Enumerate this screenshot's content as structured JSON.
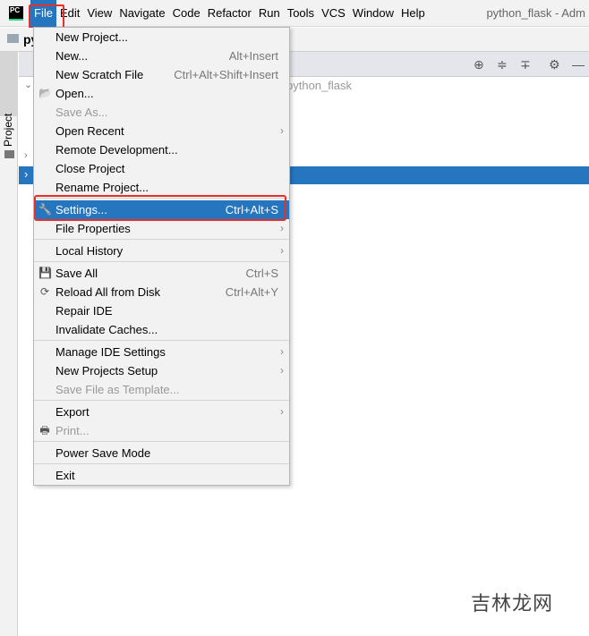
{
  "menubar": {
    "items": [
      "File",
      "Edit",
      "View",
      "Navigate",
      "Code",
      "Refactor",
      "Run",
      "Tools",
      "VCS",
      "Window",
      "Help"
    ],
    "title": "python_flask - Adm",
    "logo": "PC"
  },
  "navbar": {
    "project": "py"
  },
  "sidebar": {
    "label": "Project"
  },
  "tree": {
    "root_path": "python_flask"
  },
  "file_menu": [
    {
      "label": "New Project...",
      "shortcut": ""
    },
    {
      "label": "New...",
      "shortcut": "Alt+Insert"
    },
    {
      "label": "New Scratch File",
      "shortcut": "Ctrl+Alt+Shift+Insert"
    },
    {
      "label": "Open...",
      "shortcut": "",
      "icon": "folder-open-icon"
    },
    {
      "label": "Save As...",
      "shortcut": "",
      "disabled": true
    },
    {
      "label": "Open Recent",
      "shortcut": "",
      "submenu": true
    },
    {
      "label": "Remote Development...",
      "shortcut": ""
    },
    {
      "label": "Close Project",
      "shortcut": ""
    },
    {
      "label": "Rename Project...",
      "shortcut": ""
    },
    {
      "separator": true
    },
    {
      "label": "Settings...",
      "shortcut": "Ctrl+Alt+S",
      "icon": "wrench-icon",
      "highlighted": true
    },
    {
      "label": "File Properties",
      "shortcut": "",
      "submenu": true
    },
    {
      "separator": true
    },
    {
      "label": "Local History",
      "shortcut": "",
      "submenu": true
    },
    {
      "separator": true
    },
    {
      "label": "Save All",
      "shortcut": "Ctrl+S",
      "icon": "save-icon"
    },
    {
      "label": "Reload All from Disk",
      "shortcut": "Ctrl+Alt+Y",
      "icon": "reload-icon"
    },
    {
      "label": "Repair IDE",
      "shortcut": ""
    },
    {
      "label": "Invalidate Caches...",
      "shortcut": ""
    },
    {
      "separator": true
    },
    {
      "label": "Manage IDE Settings",
      "shortcut": "",
      "submenu": true
    },
    {
      "label": "New Projects Setup",
      "shortcut": "",
      "submenu": true
    },
    {
      "label": "Save File as Template...",
      "shortcut": "",
      "disabled": true
    },
    {
      "separator": true
    },
    {
      "label": "Export",
      "shortcut": "",
      "submenu": true
    },
    {
      "label": "Print...",
      "shortcut": "",
      "icon": "print-icon",
      "disabled": true
    },
    {
      "separator": true
    },
    {
      "label": "Power Save Mode",
      "shortcut": ""
    },
    {
      "separator": true
    },
    {
      "label": "Exit",
      "shortcut": ""
    }
  ],
  "watermark": "吉林龙网",
  "colors": {
    "accent": "#2675bf",
    "annotation": "#e8302a"
  }
}
